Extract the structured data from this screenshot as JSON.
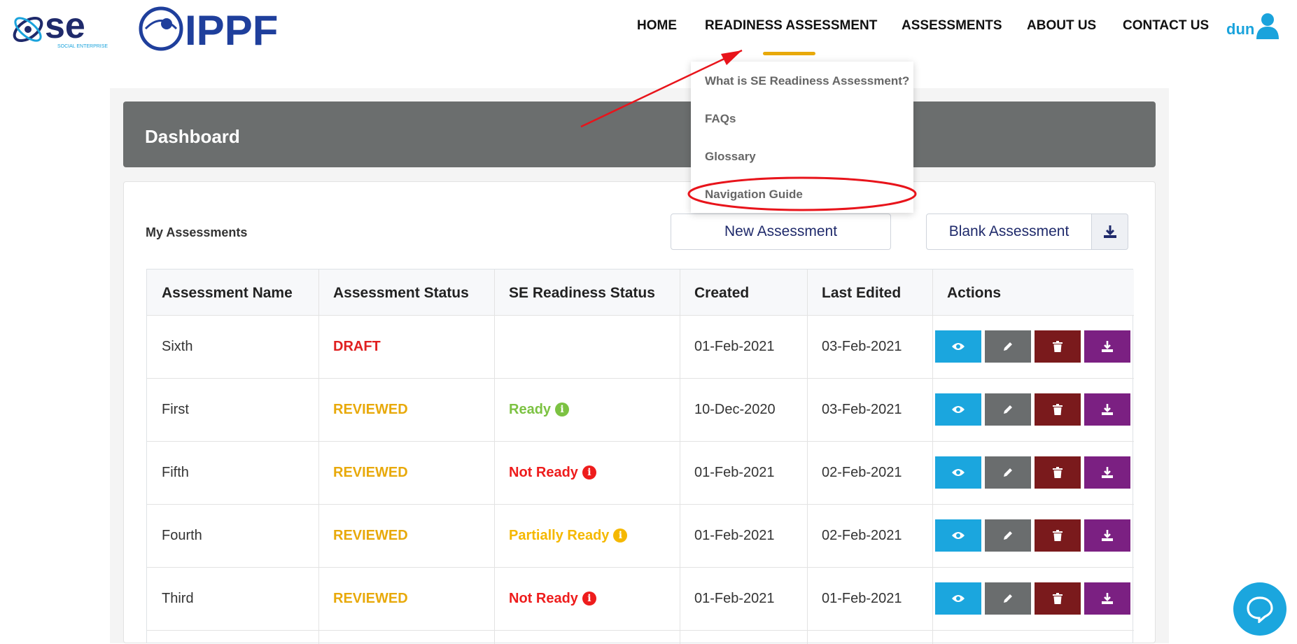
{
  "brand": {
    "se_logo_text": "se",
    "se_logo_sub": "SOCIAL ENTERPRISE",
    "ippf_logo_text": "IPPF"
  },
  "nav": {
    "items": [
      {
        "label": "HOME"
      },
      {
        "label": "READINESS ASSESSMENT"
      },
      {
        "label": "ASSESSMENTS"
      },
      {
        "label": "ABOUT US"
      },
      {
        "label": "CONTACT US"
      }
    ],
    "user_name": "dun",
    "active_color": "#e8a90a"
  },
  "dropdown": {
    "items": [
      {
        "label": "What is SE Readiness Assessment?"
      },
      {
        "label": "FAQs"
      },
      {
        "label": "Glossary"
      },
      {
        "label": "Navigation Guide"
      }
    ]
  },
  "dashboard": {
    "title": "Dashboard",
    "section_label": "My Assessments",
    "new_assessment_label": "New Assessment",
    "blank_assessment_label": "Blank Assessment"
  },
  "table": {
    "headers": [
      "Assessment Name",
      "Assessment Status",
      "SE Readiness Status",
      "Created",
      "Last Edited",
      "Actions"
    ],
    "rows": [
      {
        "name": "Sixth",
        "status": "DRAFT",
        "readiness": "",
        "created": "01-Feb-2021",
        "edited": "03-Feb-2021"
      },
      {
        "name": "First",
        "status": "REVIEWED",
        "readiness": "Ready",
        "created": "10-Dec-2020",
        "edited": "03-Feb-2021"
      },
      {
        "name": "Fifth",
        "status": "REVIEWED",
        "readiness": "Not Ready",
        "created": "01-Feb-2021",
        "edited": "02-Feb-2021"
      },
      {
        "name": "Fourth",
        "status": "REVIEWED",
        "readiness": "Partially Ready",
        "created": "01-Feb-2021",
        "edited": "02-Feb-2021"
      },
      {
        "name": "Third",
        "status": "REVIEWED",
        "readiness": "Not Ready",
        "created": "01-Feb-2021",
        "edited": "01-Feb-2021"
      }
    ]
  },
  "colors": {
    "accent_blue": "#1ba6de",
    "draft_red": "#e02020",
    "reviewed_amber": "#e8a90a",
    "ready_green": "#7cc242",
    "not_ready_red": "#ee1c1c",
    "partial_yellow": "#f5b800",
    "annotation_red": "#e8141b"
  },
  "icons": {
    "view": "eye-icon",
    "edit": "pencil-icon",
    "delete": "trash-icon",
    "download": "download-icon",
    "info": "info-icon",
    "chat": "chat-icon",
    "user": "user-icon"
  }
}
